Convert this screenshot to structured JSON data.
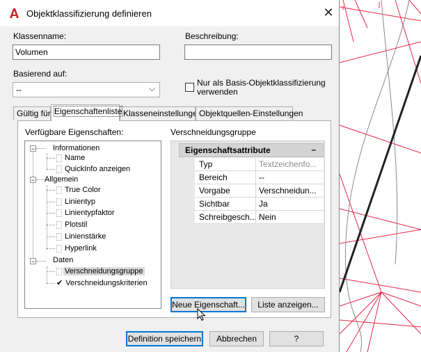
{
  "dialog": {
    "title": "Objektklassifizierung definieren",
    "close_label": "✕",
    "class_name_label": "Klassenname:",
    "class_name_value": "Volumen",
    "description_label": "Beschreibung:",
    "description_value": "",
    "based_on_label": "Basierend auf:",
    "based_on_value": "--",
    "base_only_checkbox_line1": "Nur als Basis-Objektklassifizierung",
    "base_only_checkbox_line2": "verwenden",
    "base_only_checked": false
  },
  "tabs": [
    {
      "label": "Gültig für"
    },
    {
      "label": "Eigenschaftenliste",
      "active": true
    },
    {
      "label": "Klasseneinstellungen"
    },
    {
      "label": "Objektquellen-Einstellungen"
    }
  ],
  "available_properties_label": "Verfügbare Eigenschaften:",
  "tree": {
    "group_informationen": "Informationen",
    "item_name": "Name",
    "item_quickinfo": "QuickInfo anzeigen",
    "group_allgemein": "Allgemein",
    "item_truecolor": "True Color",
    "item_linientyp": "Linientyp",
    "item_linientypfaktor": "Linientypfaktor",
    "item_plotstil": "Plotstil",
    "item_linienstaerke": "Linienstärke",
    "item_hyperlink": "Hyperlink",
    "group_daten": "Daten",
    "item_verschneidungsgruppe": "Verschneidungsgruppe",
    "item_verschneidungskriterien": "Verschneidungskriterien"
  },
  "selected_property_label": "Verschneidungsgruppe",
  "property_attributes": {
    "header": "Eigenschaftsattribute",
    "collapse": "–",
    "rows": [
      {
        "key": "Typ",
        "value": "Textzeichenfo..."
      },
      {
        "key": "Bereich",
        "value": "--"
      },
      {
        "key": "Vorgabe",
        "value": "Verschneidun..."
      },
      {
        "key": "Sichtbar",
        "value": "Ja"
      },
      {
        "key": "Schreibgesch...",
        "value": "Nein"
      }
    ]
  },
  "buttons": {
    "new_property": "Neue Eigenschaft...",
    "show_list": "Liste anzeigen...",
    "save_definition": "Definition speichern",
    "cancel": "Abbrechen",
    "help": "?"
  },
  "colors": {
    "accent": "#0078d7",
    "app_icon": "#c4262e",
    "drawing_red": "#e8264a"
  }
}
